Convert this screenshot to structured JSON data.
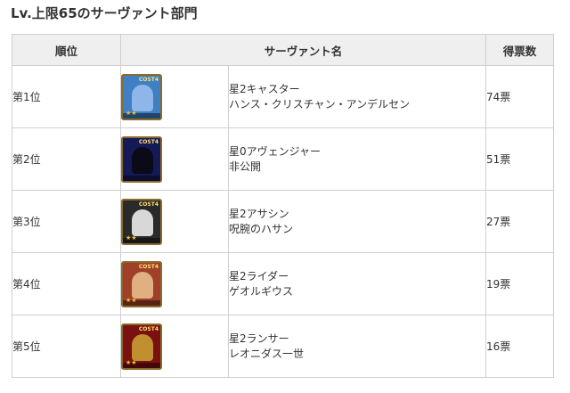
{
  "title": "Lv.上限65のサーヴァント部門",
  "table": {
    "headers": {
      "rank": "順位",
      "servant": "サーヴァント名",
      "votes": "得票数"
    },
    "rows": [
      {
        "rank": "第1位",
        "class_line": "星2キャスター",
        "name": "ハンス・クリスチャン・アンデルセン",
        "votes": "74票",
        "card_bg": "#3f7fc4",
        "card_fig": "#8fb6e8",
        "cost": "COST4",
        "stars": "★★"
      },
      {
        "rank": "第2位",
        "class_line": "星0アヴェンジャー",
        "name": "非公開",
        "votes": "51票",
        "card_bg": "#141a55",
        "card_fig": "#0a0a18",
        "cost": "COST4",
        "stars": ""
      },
      {
        "rank": "第3位",
        "class_line": "星2アサシン",
        "name": "呪腕のハサン",
        "votes": "27票",
        "card_bg": "#2a2a2a",
        "card_fig": "#d8d8d8",
        "cost": "COST4",
        "stars": "★★"
      },
      {
        "rank": "第4位",
        "class_line": "星2ライダー",
        "name": "ゲオルギウス",
        "votes": "19票",
        "card_bg": "#a0402a",
        "card_fig": "#e0b080",
        "cost": "COST4",
        "stars": "★★"
      },
      {
        "rank": "第5位",
        "class_line": "星2ランサー",
        "name": "レオニダス一世",
        "votes": "16票",
        "card_bg": "#7a1010",
        "card_fig": "#c09030",
        "cost": "COST4",
        "stars": "★★"
      }
    ]
  }
}
